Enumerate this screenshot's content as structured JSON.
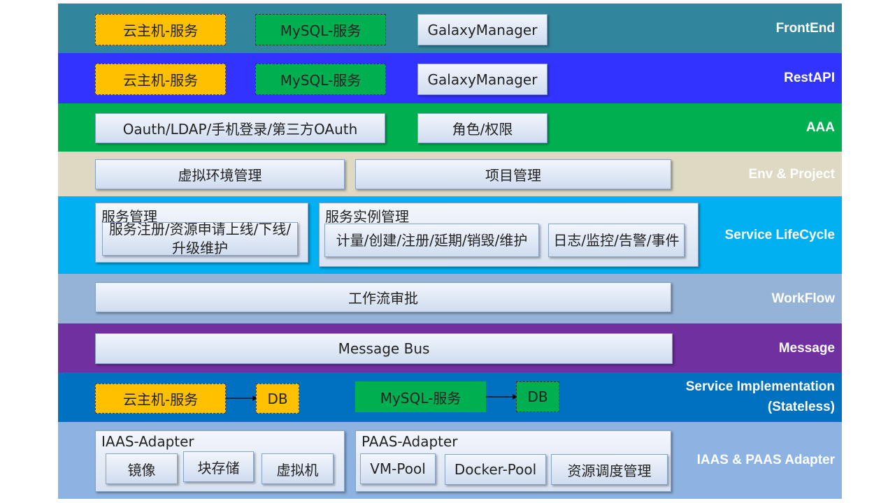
{
  "layers": {
    "frontend": {
      "label": "FrontEnd",
      "color": "#31859c",
      "items": [
        "云主机-服务",
        "MySQL-服务",
        "GalaxyManager"
      ]
    },
    "restapi": {
      "label": "RestAPI",
      "color": "#3333ff",
      "items": [
        "云主机-服务",
        "MySQL-服务",
        "GalaxyManager"
      ]
    },
    "aaa": {
      "label": "AAA",
      "color": "#00b050",
      "items": [
        "Oauth/LDAP/手机登录/第三方OAuth",
        "角色/权限"
      ]
    },
    "env": {
      "label": "Env & Project",
      "color": "#ddd9c3",
      "items": [
        "虚拟环境管理",
        "项目管理"
      ]
    },
    "lifecycle": {
      "label": "Service LifeCycle",
      "color": "#00b0f0",
      "service_mgmt": {
        "title": "服务管理",
        "item": "服务注册/资源申请上线/下线/升级维护"
      },
      "instance_mgmt": {
        "title": "服务实例管理",
        "items": [
          "计量/创建/注册/延期/销毁/维护",
          "日志/监控/告警/事件"
        ]
      }
    },
    "workflow": {
      "label": "WorkFlow",
      "color": "#95b3d7",
      "item": "工作流审批"
    },
    "message": {
      "label": "Message",
      "color": "#7030a0",
      "item": "Message Bus"
    },
    "implementation": {
      "label_line1": "Service Implementation",
      "label_line2": "(Stateless)",
      "color": "#0070c0",
      "items": [
        "云主机-服务",
        "DB",
        "MySQL-服务",
        "DB"
      ]
    },
    "adapter": {
      "label": "IAAS & PAAS Adapter",
      "color": "#8db3e2",
      "iaas": {
        "title": "IAAS-Adapter",
        "items": [
          "镜像",
          "块存储",
          "虚拟机"
        ]
      },
      "paas": {
        "title": "PAAS-Adapter",
        "items": [
          "VM-Pool",
          "Docker-Pool",
          "资源调度管理"
        ]
      }
    }
  }
}
